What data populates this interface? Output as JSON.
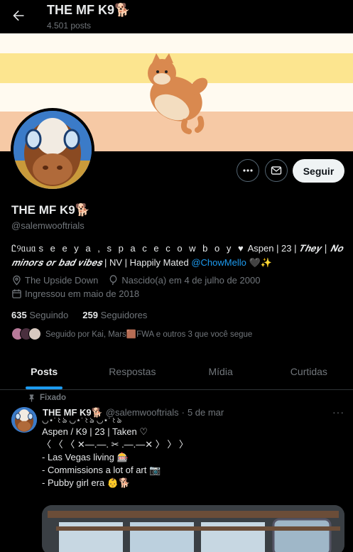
{
  "header": {
    "title": "THE MF K9🐕",
    "posts_count": "4.501 posts"
  },
  "banner": {
    "colors": [
      "#fffaf0",
      "#fce58f",
      "#fffaf0",
      "#f6c9a5"
    ]
  },
  "profile": {
    "name": "THE MF K9🐕",
    "handle": "@salemwooftrials",
    "bio_part1": "Ꮭ୨ᥲᥙᥲ ",
    "bio_part2": "s e e y a ,   s p a c e   c o w b o y ♥",
    "bio_part3": " Aspen | 23 | ",
    "bio_part4": "𝑻𝒉𝒆𝒚 | 𝑵𝒐 𝒎𝒊𝒏𝒐𝒓𝒔 𝒐𝒓 𝒃𝒂𝒅 𝒗𝒊𝒃𝒆𝒔",
    "bio_part5": " | NV | Happily Mated ",
    "bio_mention": "@ChowMello",
    "bio_end": " 🖤✨",
    "location": "The Upside Down",
    "birthday": "Nascido(a) em 4 de julho de 2000",
    "joined": "Ingressou em maio de 2018",
    "following_count": "635",
    "following_label": "Seguindo",
    "followers_count": "259",
    "followers_label": "Seguidores",
    "followed_by": "Seguido por Kai, Mars🟫FWA e outros 3 que você segue"
  },
  "actions": {
    "follow_label": "Seguir"
  },
  "tabs": [
    {
      "label": "Posts"
    },
    {
      "label": "Respostas"
    },
    {
      "label": "Mídia"
    },
    {
      "label": "Curtidas"
    }
  ],
  "post": {
    "pinned_label": "Fixado",
    "author": "THE MF K9🐕",
    "handle": "@salemwooftrials",
    "dot": "·",
    "date": "5 de mar",
    "line0": "◡̈⋆˚꒰ঌ ◡̈⋆˚꒰ঌ ◡̈⋆˚꒰ঌ",
    "line1": "Aspen / K9 | 23 | Taken ♡",
    "line2": "〈 〈 〈 ✕—.—. ✂ .—.—✕ 〉 〉 〉",
    "line3": "- Las Vegas living 🎰",
    "line4": "- Commissions a lot of art 📷",
    "line5": "- Pubby girl era 👶🐕"
  }
}
